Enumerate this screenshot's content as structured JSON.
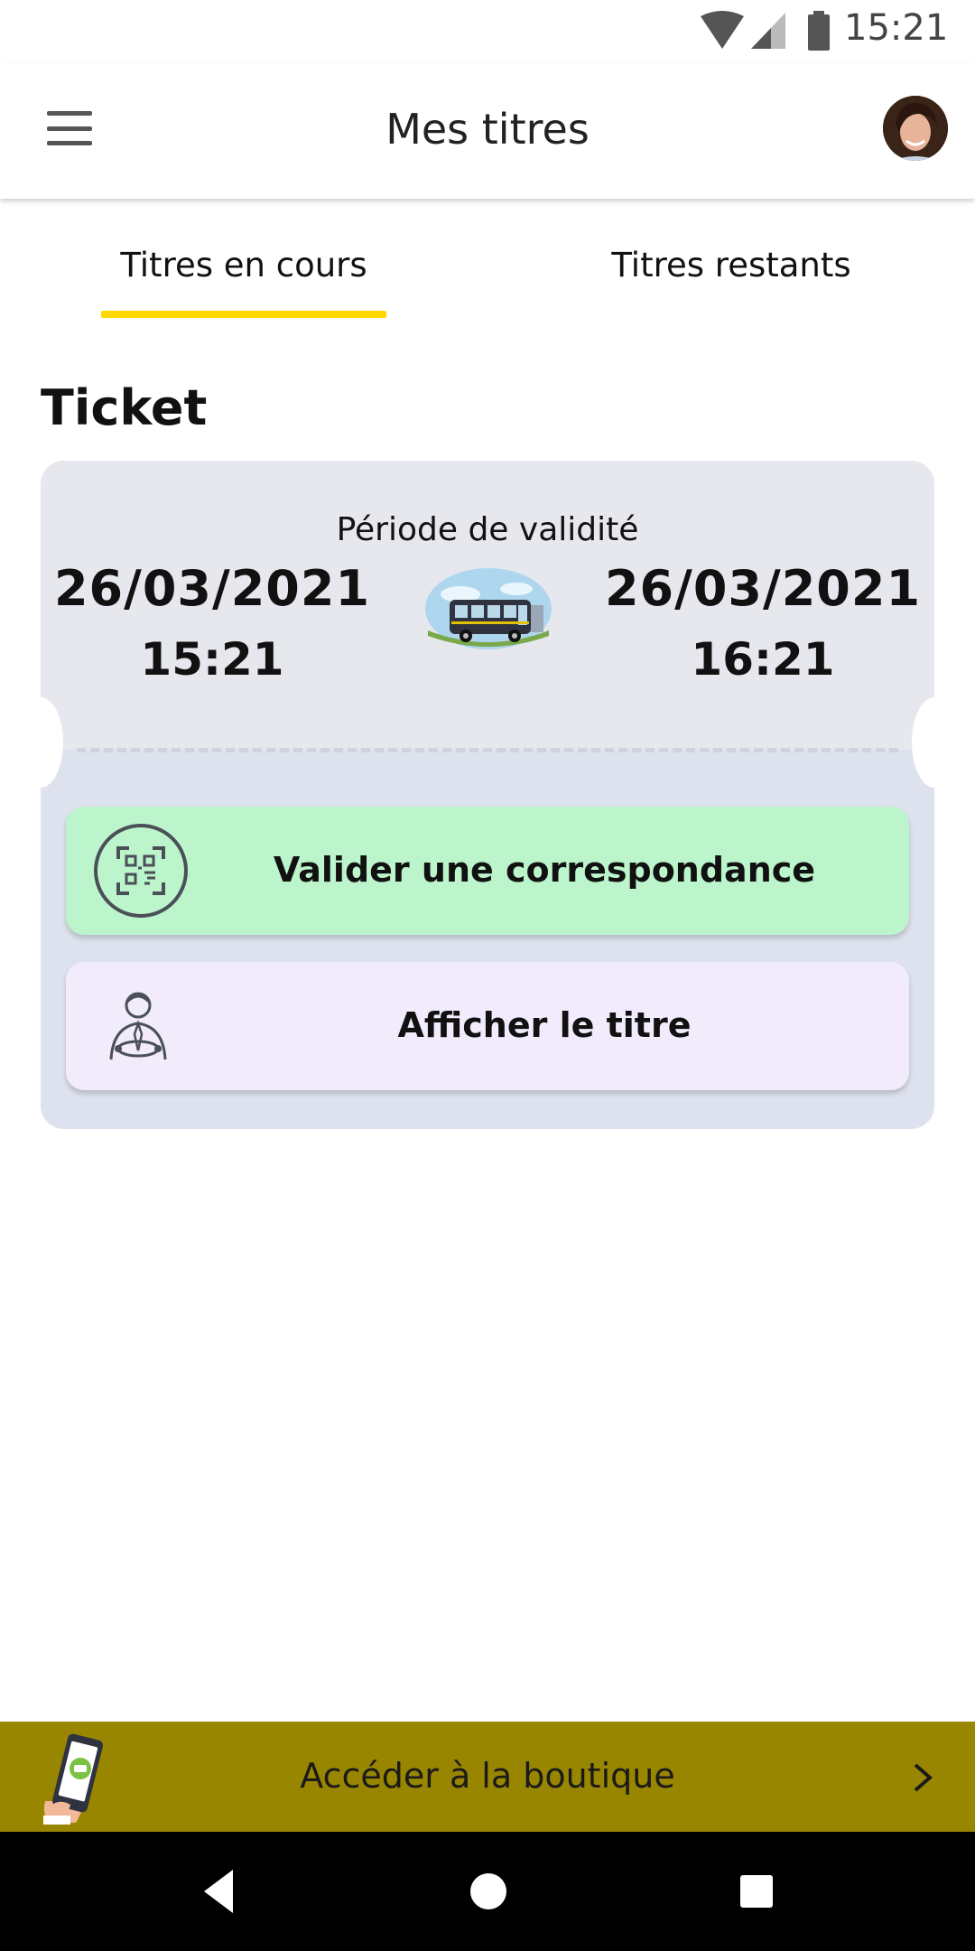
{
  "status_bar": {
    "time": "15:21",
    "icons": [
      "wifi-icon",
      "cell-signal-icon",
      "battery-icon"
    ]
  },
  "app_bar": {
    "title": "Mes titres",
    "menu_icon": "hamburger-menu-icon",
    "avatar": "user-avatar"
  },
  "tabs": [
    {
      "label": "Titres en cours",
      "active": true
    },
    {
      "label": "Titres restants",
      "active": false
    }
  ],
  "section": {
    "title": "Ticket"
  },
  "ticket": {
    "validity_label": "Période de validité",
    "start": {
      "date": "26/03/2021",
      "time": "15:21"
    },
    "end": {
      "date": "26/03/2021",
      "time": "16:21"
    },
    "illustration": "bus-illustration",
    "actions": [
      {
        "label": "Valider une correspondance",
        "icon": "qr-scan-icon",
        "color": "#bcf5cc"
      },
      {
        "label": "Afficher le titre",
        "icon": "driver-icon",
        "color": "#f1ebfc"
      }
    ]
  },
  "shop_banner": {
    "label": "Accéder à la boutique",
    "color": "#998600",
    "icons": [
      "phone-ticket-icon",
      "chevron-right-icon"
    ]
  },
  "nav_bar": {
    "icons": [
      "back-icon",
      "home-icon",
      "recents-icon"
    ]
  },
  "colors": {
    "accent": "#ffd800",
    "ticket_bg": "#e6e8ee"
  }
}
